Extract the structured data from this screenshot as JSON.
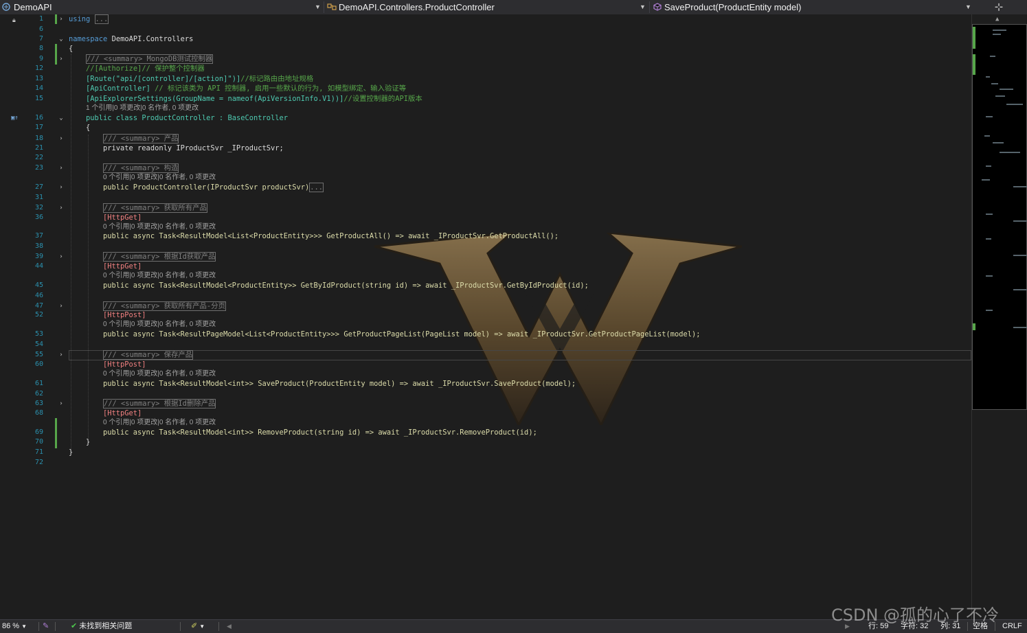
{
  "navbar": {
    "project": "DemoAPI",
    "type": "DemoAPI.Controllers.ProductController",
    "member": "SaveProduct(ProductEntity model)"
  },
  "editor": {
    "line_numbers": [
      "1",
      "6",
      "7",
      "8",
      "9",
      "12",
      "13",
      "14",
      "15",
      "16",
      "17",
      "18",
      "21",
      "22",
      "23",
      "27",
      "31",
      "32",
      "36",
      "37",
      "38",
      "39",
      "44",
      "45",
      "46",
      "47",
      "52",
      "53",
      "54",
      "55",
      "60",
      "61",
      "62",
      "63",
      "68",
      "69",
      "70",
      "71",
      "72"
    ],
    "codelens": "0 个引用|0 项更改|0 名作者, 0 项更改",
    "codelens_class": "1 个引用|0 项更改|0 名作者, 0 项更改",
    "ellipsis": "...",
    "using": "using",
    "namespace_kw": "namespace",
    "namespace_name": "DemoAPI.Controllers",
    "brace_open": "{",
    "brace_close": "}",
    "summary_class": "/// <summary> MongoDB测试控制器",
    "authorize_comment": "//[Authorize]// 保护整个控制器",
    "route_attr": "[Route(\"api/[controller]/[action]\")]",
    "route_comment": "//标记路由由地址规格",
    "apicontroller_attr": "[ApiController]",
    "apicontroller_comment": "// 标记该类为 API 控制器, 启用一些默认的行为, 如模型绑定、输入验证等",
    "explorer_attr": "[ApiExplorerSettings(GroupName = nameof(ApiVersionInfo.V1))]",
    "explorer_comment": "//设置控制器的API版本",
    "class_decl": "public class ProductController : BaseController",
    "summary_field": "/// <summary> 产品",
    "field_decl": "private readonly IProductSvr _IProductSvr;",
    "summary_ctor": "/// <summary> 构造",
    "ctor_decl": "public ProductController(IProductSvr productSvr)",
    "summary_getall": "/// <summary> 获取所有产品",
    "httpget": "[HttpGet]",
    "httppost": "[HttpPost]",
    "getall_decl": "public async Task<ResultModel<List<ProductEntity>>> GetProductAll() => await _IProductSvr.GetProductAll();",
    "summary_getbyid": "/// <summary> 根据Id获取产品",
    "getbyid_decl": "public async Task<ResultModel<ProductEntity>> GetByIdProduct(string id) => await _IProductSvr.GetByIdProduct(id);",
    "summary_page": "/// <summary> 获取所有产品-分页",
    "page_decl": "public async Task<ResultPageModel<List<ProductEntity>>> GetProductPageList(PageList model) => await _IProductSvr.GetProductPageList(model);",
    "summary_save": "/// <summary> 保存产品",
    "save_decl": "public async Task<ResultModel<int>> SaveProduct(ProductEntity model) => await _IProductSvr.SaveProduct(model);",
    "summary_remove": "/// <summary> 根据Id删除产品",
    "remove_decl": "public async Task<ResultModel<int>> RemoveProduct(string id) => await _IProductSvr.RemoveProduct(id);"
  },
  "statusbar": {
    "zoom": "86 %",
    "issues": "未找到相关问题",
    "line": "行: 59",
    "char": "字符: 32",
    "col": "列: 31",
    "whitespace": "空格",
    "eol": "CRLF"
  },
  "watermark": "CSDN @孤的心了不冷",
  "colors": {
    "keyword": "#569cd6",
    "type": "#4ec9b0",
    "method": "#dcdcaa",
    "comment": "#57a64a",
    "change_bar": "#57a64a",
    "line_number": "#2b91af"
  }
}
